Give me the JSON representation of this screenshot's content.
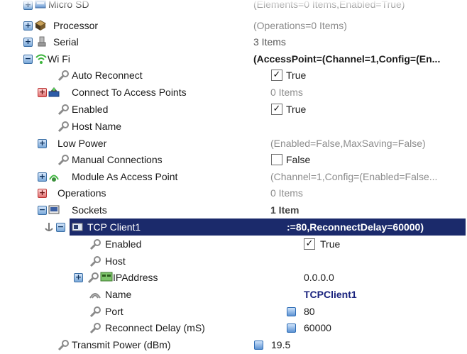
{
  "rows": [
    {
      "name": "Micro SD",
      "value": "(Elements=0 Items,Enabled=True)"
    },
    {
      "name": "Processor",
      "value": "(Operations=0 Items)"
    },
    {
      "name": "Serial",
      "value": "3 Items"
    },
    {
      "name": "Wi Fi",
      "value": "(AccessPoint=(Channel=1,Config=(En..."
    },
    {
      "name": "Auto Reconnect",
      "value": "True"
    },
    {
      "name": "Connect To Access Points",
      "value": "0 Items"
    },
    {
      "name": "Enabled",
      "value": "True"
    },
    {
      "name": "Host Name",
      "value": ""
    },
    {
      "name": "Low Power",
      "value": "(Enabled=False,MaxSaving=False)"
    },
    {
      "name": "Manual Connections",
      "value": "False"
    },
    {
      "name": "Module As Access Point",
      "value": "(Channel=1,Config=(Enabled=False..."
    },
    {
      "name": "Operations",
      "value": "0 Items"
    },
    {
      "name": "Sockets",
      "value": "1 Item"
    },
    {
      "name": "TCP Client1",
      "value": ":=80,ReconnectDelay=60000)"
    },
    {
      "name": "Enabled",
      "value": "True"
    },
    {
      "name": "Host",
      "value": ""
    },
    {
      "name": "IPAddress",
      "value": "0.0.0.0"
    },
    {
      "name": "Name",
      "value": "TCPClient1"
    },
    {
      "name": "Port",
      "value": "80"
    },
    {
      "name": "Reconnect Delay (mS)",
      "value": "60000"
    },
    {
      "name": "Transmit Power (dBm)",
      "value": "19.5"
    }
  ],
  "checks": {
    "auto_reconnect": true,
    "enabled": true,
    "manual_connections": false,
    "tcp_enabled": true
  },
  "colors": {
    "selection": "#1b2a6b",
    "gray_text": "#8c8c8c",
    "name_value": "#1a237e"
  }
}
